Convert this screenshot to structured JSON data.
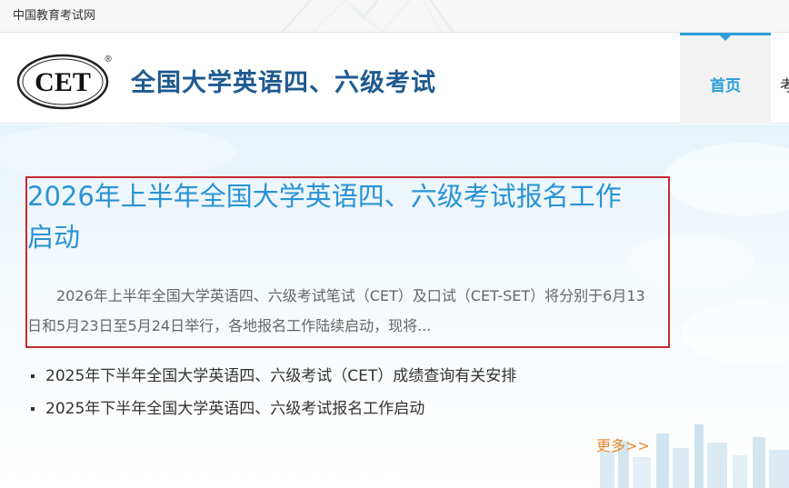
{
  "topbar": {
    "site_name": "中国教育考试网"
  },
  "header": {
    "logo_text": "CET",
    "logo_mark": "®",
    "brand": "全国大学英语四、六级考试"
  },
  "nav": {
    "items": [
      {
        "label": "首页",
        "active": true
      },
      {
        "label": "考"
      }
    ]
  },
  "featured": {
    "title": "2026年上半年全国大学英语四、六级考试报名工作启动",
    "summary": "2026年上半年全国大学英语四、六级考试笔试（CET）及口试（CET-SET）将分别于6月13日和5月23日至5月24日举行，各地报名工作陆续启动，现将..."
  },
  "news": [
    {
      "title": "2025年下半年全国大学英语四、六级考试（CET）成绩查询有关安排"
    },
    {
      "title": "2025年下半年全国大学英语四、六级考试报名工作启动"
    }
  ],
  "more_label": "更多>>",
  "colors": {
    "accent": "#2a9fd8",
    "brand": "#1f5a8f",
    "title_link": "#2a93d4",
    "more": "#e8862d",
    "highlight_border": "#c62a2f"
  }
}
